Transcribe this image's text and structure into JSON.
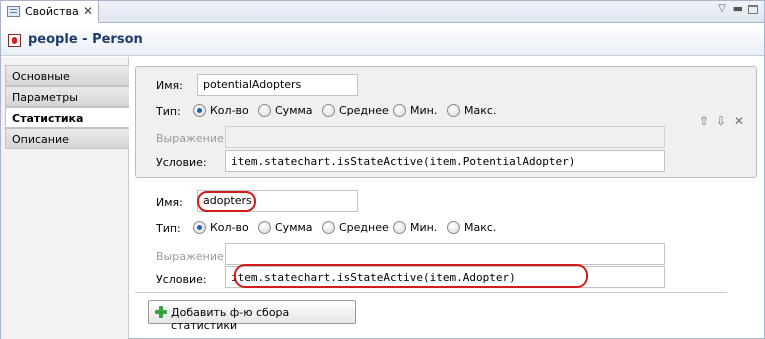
{
  "tab": {
    "label": "Свойства"
  },
  "header": {
    "title": "people - Person"
  },
  "sidebar": {
    "items": [
      {
        "label": "Основные"
      },
      {
        "label": "Параметры"
      },
      {
        "label": "Статистика"
      },
      {
        "label": "Описание"
      }
    ]
  },
  "stats": [
    {
      "name_label": "Имя:",
      "name": "potentialAdopters",
      "type_label": "Тип:",
      "types": [
        "Кол-во",
        "Сумма",
        "Среднее",
        "Мин.",
        "Макс."
      ],
      "selected_type": "Кол-во",
      "expression_label": "Выражение:",
      "expression": "",
      "condition_label": "Условие:",
      "condition": "item.statechart.isStateActive(item.PotentialAdopter)"
    },
    {
      "name_label": "Имя:",
      "name": "adopters",
      "type_label": "Тип:",
      "types": [
        "Кол-во",
        "Сумма",
        "Среднее",
        "Мин.",
        "Макс."
      ],
      "selected_type": "Кол-во",
      "expression_label": "Выражение:",
      "expression": "",
      "condition_label": "Условие:",
      "condition": "item.statechart.isStateActive(item.Adopter)"
    }
  ],
  "add_button": {
    "label": "Добавить ф-ю сбора статистики"
  },
  "colors": {
    "annotation": "#d21b1b",
    "title": "#1f3b6b",
    "selected_radio": "#1f5fbf",
    "add_icon": "#35a33a"
  }
}
